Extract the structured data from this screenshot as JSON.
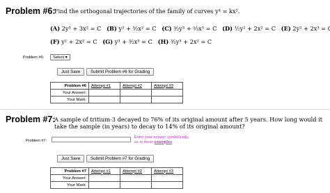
{
  "p6": {
    "title": "Problem #6:",
    "question": "Find the orthogonal trajectories of the family of curves y⁴ = kx².",
    "row1": [
      {
        "label": "(A)",
        "expr": "2y³ + 3x² = C"
      },
      {
        "label": "(B)",
        "expr": "y² + ³⁄₂x² = C"
      },
      {
        "label": "(C)",
        "expr": "³⁄₂y³ + ⁵⁄₃x³ = C"
      },
      {
        "label": "(D)",
        "expr": "½y² + 2x² = C"
      },
      {
        "label": "(E)",
        "expr": "2y² + 2x³ = C"
      }
    ],
    "row2": [
      {
        "label": "(F)",
        "expr": "y² + 2x² = C"
      },
      {
        "label": "(G)",
        "expr": "y³ + ³⁄₂x³ = C"
      },
      {
        "label": "(H)",
        "expr": "³⁄₂y³ + 2x² = C"
      }
    ],
    "select_label": "Problem #6:",
    "select_value": "Select",
    "just_save": "Just Save",
    "submit": "Submit Problem #6 for Grading",
    "table": {
      "header": "Problem #6",
      "attempts": [
        "Attempt #1",
        "Attempt #2",
        "Attempt #3"
      ],
      "row_answer": "Your Answer:",
      "row_mark": "Your Mark:"
    }
  },
  "p7": {
    "title": "Problem #7:",
    "question": "A sample of tritium-3 decayed to 76% of its original amount after 5 years. How long would it take the sample (in years) to decay to 14% of its original amount?",
    "input_label": "Problem #7:",
    "input_value": "",
    "hint_line1": "Enter your answer symbolically,",
    "hint_line2_prefix": "as in these ",
    "hint_link": "examples",
    "just_save": "Just Save",
    "submit": "Submit Problem #7 for Grading",
    "table": {
      "header": "Problem #7",
      "attempts": [
        "Attempt #1",
        "Attempt #2",
        "Attempt #3"
      ],
      "row_answer": "Your Answer:",
      "row_mark": "Your Mark:"
    }
  }
}
